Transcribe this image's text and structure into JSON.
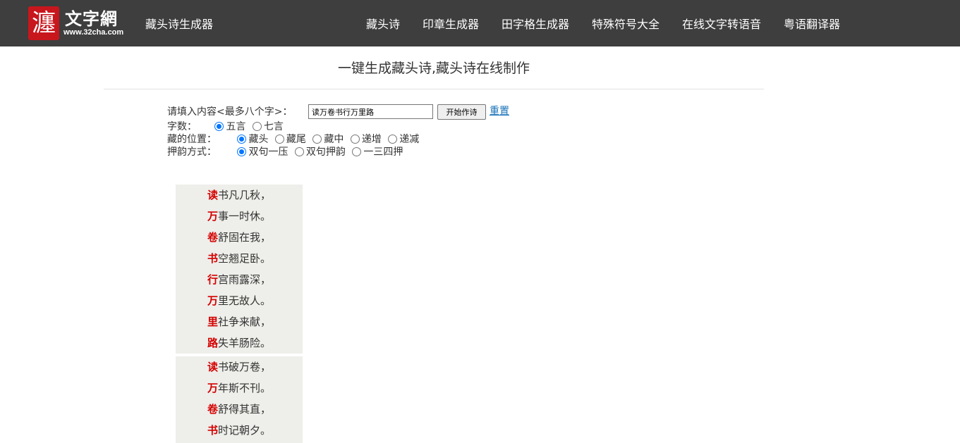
{
  "header": {
    "logo_seal_char": "瀍",
    "logo_name": "文字網",
    "logo_url": "www.32cha.com",
    "site_title": "藏头诗生成器",
    "nav": [
      "藏头诗",
      "印章生成器",
      "田字格生成器",
      "特殊符号大全",
      "在线文字转语音",
      "粤语翻译器"
    ]
  },
  "main": {
    "title": "一键生成藏头诗,藏头诗在线制作"
  },
  "form": {
    "input_label": "请填入内容<最多八个字>：",
    "input_value": "读万卷书行万里路",
    "start_button": "开始作诗",
    "reset_link": "重置",
    "word_count": {
      "label": "字数：",
      "options": [
        {
          "label": "五言",
          "checked": true
        },
        {
          "label": "七言",
          "checked": false
        }
      ]
    },
    "position": {
      "label": "藏的位置：",
      "options": [
        {
          "label": "藏头",
          "checked": true
        },
        {
          "label": "藏尾",
          "checked": false
        },
        {
          "label": "藏中",
          "checked": false
        },
        {
          "label": "递增",
          "checked": false
        },
        {
          "label": "递减",
          "checked": false
        }
      ]
    },
    "rhyme": {
      "label": "押韵方式：",
      "options": [
        {
          "label": "双句一压",
          "checked": true
        },
        {
          "label": "双句押韵",
          "checked": false
        },
        {
          "label": "一三四押",
          "checked": false
        }
      ]
    }
  },
  "poems": [
    {
      "lines": [
        {
          "head": "读",
          "rest": "书凡几秋，"
        },
        {
          "head": "万",
          "rest": "事一时休。"
        },
        {
          "head": "卷",
          "rest": "舒固在我，"
        },
        {
          "head": "书",
          "rest": "空翘足卧。"
        },
        {
          "head": "行",
          "rest": "宫雨露深，"
        },
        {
          "head": "万",
          "rest": "里无故人。"
        },
        {
          "head": "里",
          "rest": "社争来献，"
        },
        {
          "head": "路",
          "rest": "失羊肠险。"
        }
      ]
    },
    {
      "lines": [
        {
          "head": "读",
          "rest": "书破万卷，"
        },
        {
          "head": "万",
          "rest": "年斯不刊。"
        },
        {
          "head": "卷",
          "rest": "舒得其直，"
        },
        {
          "head": "书",
          "rest": "时记朝夕。"
        }
      ]
    }
  ]
}
